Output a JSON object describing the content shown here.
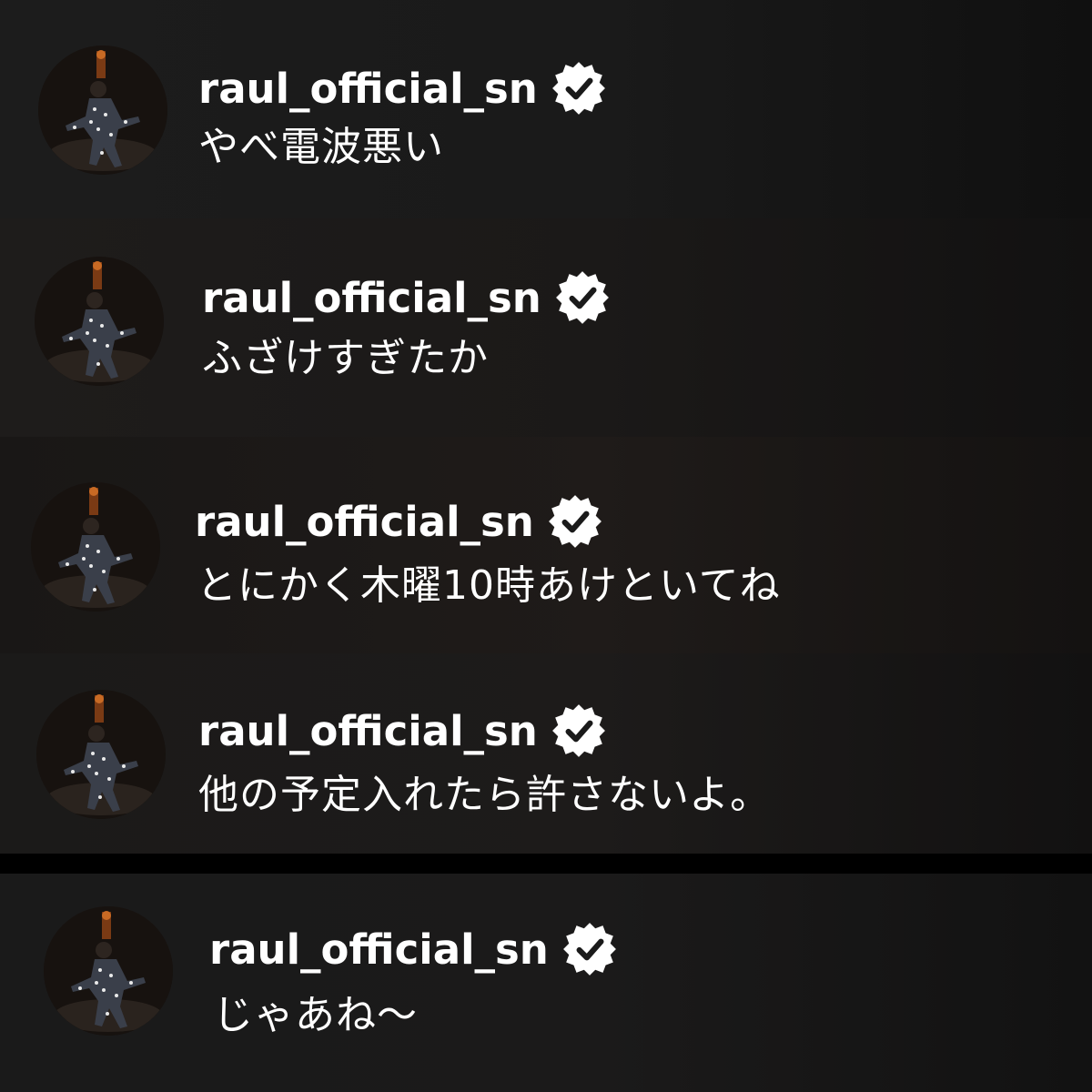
{
  "comments": [
    {
      "username": "raul_official_sn",
      "verified_icon": "verified-badge-icon",
      "text": "やべ電波悪い"
    },
    {
      "username": "raul_official_sn",
      "verified_icon": "verified-badge-icon",
      "text": "ふざけすぎたか"
    },
    {
      "username": "raul_official_sn",
      "verified_icon": "verified-badge-icon",
      "text": "とにかく木曜10時あけといてね"
    },
    {
      "username": "raul_official_sn",
      "verified_icon": "verified-badge-icon",
      "text": "他の予定入れたら許さないよ。"
    },
    {
      "username": "raul_official_sn",
      "verified_icon": "verified-badge-icon",
      "text": "じゃあね〜"
    }
  ],
  "colors": {
    "text": "#ffffff",
    "background": "#1a1a1a",
    "badge": "#ffffff"
  }
}
